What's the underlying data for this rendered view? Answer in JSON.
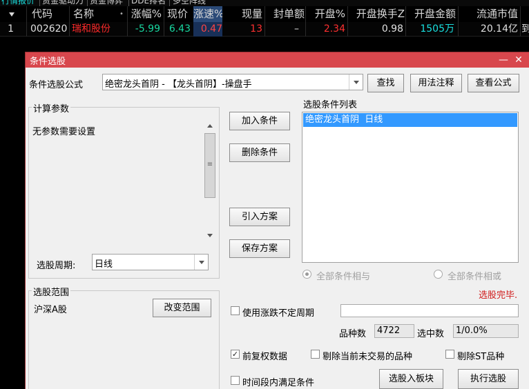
{
  "tabs": [
    "行情报价",
    "资金驱动力",
    "资金博弈",
    "DDE排名",
    "多空阵线"
  ],
  "table": {
    "headers": [
      "代码",
      "名称",
      "涨幅%",
      "现价",
      "涨速%",
      "现量",
      "封单额",
      "开盘%",
      "开盘换手Z",
      "开盘金额",
      "流通市值"
    ],
    "name_dot": "•",
    "row": {
      "index": "1",
      "code": "002620",
      "name": "瑞和股份",
      "change_pct": "-5.99",
      "price": "6.43",
      "speed_pct": "0.47",
      "volume": "13",
      "seal_amount": "–",
      "open_pct": "2.34",
      "open_turnover": "0.98",
      "open_amount": "1505万",
      "float_cap": "20.14亿",
      "more": "到"
    },
    "colors": {
      "code": "#e0e0e0",
      "name": "#ff2a2a",
      "down": "#18d7a0",
      "price": "#ff3030",
      "speed": "#ff4444",
      "up": "#ff3030",
      "neutral": "#e0e0e0",
      "open_amount": "#19e0e0",
      "header_highlight": "#2b4a78"
    }
  },
  "dialog": {
    "title": "条件选股",
    "formula_label": "条件选股公式",
    "formula_value": "绝密龙头首阴 - 【龙头首阴】-操盘手",
    "find_btn": "查找",
    "usage_btn": "用法注释",
    "view_btn": "查看公式",
    "params_group": "计算参数",
    "params_text": "无参数需要设置",
    "period_label": "选股周期:",
    "period_value": "日线",
    "add_btn": "加入条件",
    "del_btn": "删除条件",
    "import_btn": "引入方案",
    "save_btn": "保存方案",
    "list_label": "选股条件列表",
    "list_items": [
      "绝密龙头首阴  日线"
    ],
    "radio_and": "全部条件相与",
    "radio_or": "全部条件相或",
    "status": "选股完毕.",
    "scope_group": "选股范围",
    "scope_value": "沪深A股",
    "change_scope_btn": "改变范围",
    "use_period_label": "使用涨跌不定周期",
    "count_label": "品种数",
    "count_value": "4722",
    "selected_label": "选中数",
    "selected_value": "1/0.0%",
    "adjusted_label": "前复权数据",
    "adjusted_checked": true,
    "exclude_untraded_label": "剔除当前未交易的品种",
    "exclude_st_label": "剔除ST品种",
    "time_range_label": "时间段内满足条件",
    "to_block_btn": "选股入板块",
    "execute_btn": "执行选股",
    "accent_color": "#d8474d",
    "selection_color": "#3399ff"
  }
}
